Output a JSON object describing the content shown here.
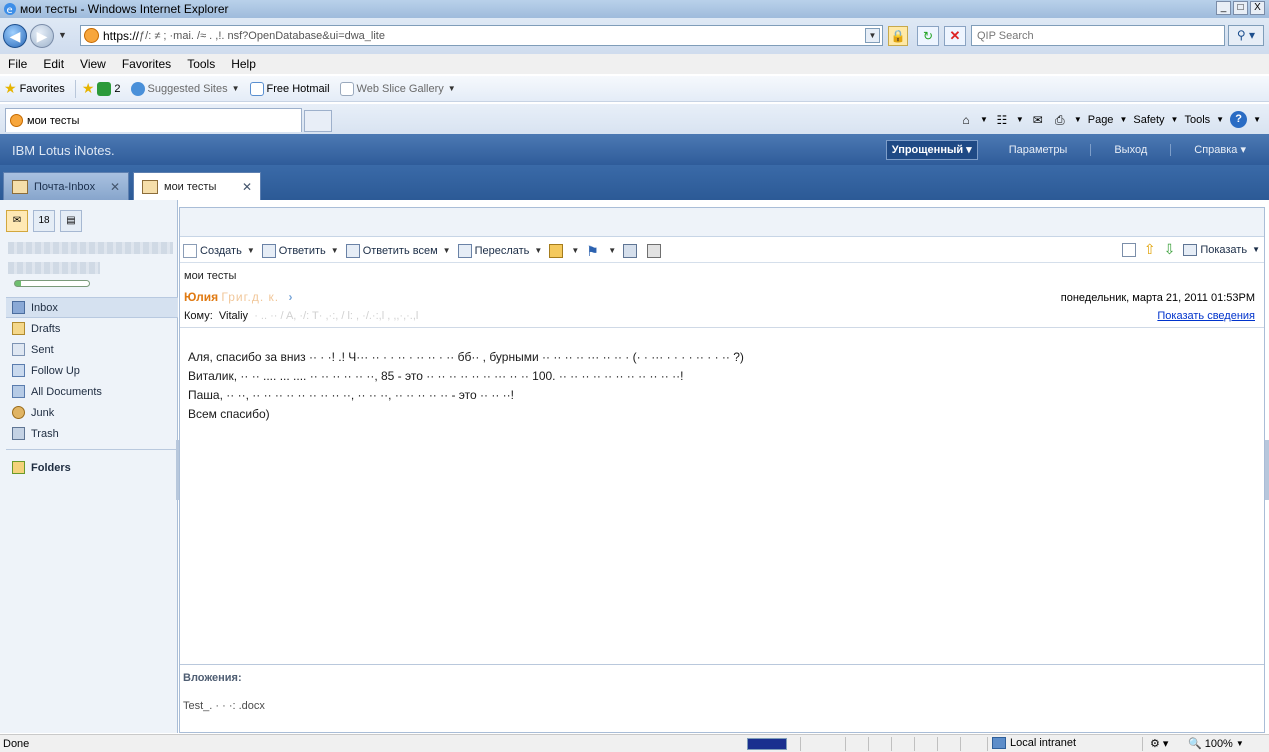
{
  "window": {
    "title": "мои тесты - Windows Internet Explorer",
    "buttons": [
      "_",
      "□",
      "X"
    ]
  },
  "address": {
    "prefix": "https://",
    "rest": "ƒ/: ≠ ; ·mai. /≈ . ,!. nsf?OpenDatabase&ui=dwa_lite",
    "search_placeholder": "QIP Search"
  },
  "menubar": [
    "File",
    "Edit",
    "View",
    "Favorites",
    "Tools",
    "Help"
  ],
  "favorites": {
    "favorites_label": "Favorites",
    "count": "2",
    "suggested": "Suggested Sites",
    "hotmail": "Free Hotmail",
    "webslice": "Web Slice Gallery"
  },
  "ie_tab": {
    "title": "мои тесты"
  },
  "commandbar": {
    "page": "Page",
    "safety": "Safety",
    "tools": "Tools"
  },
  "inotes": {
    "brand": "IBM Lotus iNotes.",
    "mode": "Упрощенный",
    "links": [
      "Параметры",
      "Выход",
      "Справка"
    ]
  },
  "apptabs": {
    "inbox_tab": "Почта-Inbox",
    "doc_tab": "мои тесты"
  },
  "sidebar": {
    "folders": [
      {
        "label": "Inbox",
        "icon": "inbox-icon"
      },
      {
        "label": "Drafts",
        "icon": "drafts-icon"
      },
      {
        "label": "Sent",
        "icon": "sent-icon"
      },
      {
        "label": "Follow Up",
        "icon": "follow-up-icon"
      },
      {
        "label": "All Documents",
        "icon": "all-documents-icon"
      },
      {
        "label": "Junk",
        "icon": "junk-icon"
      },
      {
        "label": "Trash",
        "icon": "trash-icon"
      }
    ],
    "folders_header": "Folders"
  },
  "toolbar": {
    "create": "Создать",
    "reply": "Ответить",
    "reply_all": "Ответить всем",
    "forward": "Переслать",
    "show": "Показать"
  },
  "message": {
    "subject": "мои тесты",
    "from": "Юлия",
    "from_rest": "Григ.д. к.",
    "date": "понедельник, марта 21, 2011 01:53PM",
    "to_label": "Кому:",
    "to_name": "Vitaliy",
    "to_rest": "· .. ·· / A, ·/: T· ,·:, / l: , ·/.·:,l , ,,·,·.,l",
    "show_details": "Показать сведения",
    "body_lines": [
      "Аля, спасибо за вниз ·· · ·! .! Ч··· ·· · · ·· · ·· ·· · ·· бб·· , бурными ·· ·· ·· ·· ··· ·· ·· · (· · ··· · · · · ·· · · ·· ?)",
      "Виталик, ·· ·· .... ... .... ·· ·· ·· ·· ·· ··, 85 - это ·· ·· ·· ·· ·· ·· ··· ·· ·· 100. ·· ·· ·· ·· ·· ·· ·· ·· ·· ·· ··!",
      "Паша, ·· ··, ·· ·· ·· ·· ·· ·· ·· ·· ··, ·· ·· ··, ·· ·· ·· ·· ·· - это ·· ·· ··!",
      "Всем спасибо)"
    ],
    "attachments_label": "Вложения:",
    "attachment_file": "Test_. · · ·: .docx"
  },
  "status": {
    "done": "Done",
    "zone": "Local intranet",
    "zoom": "100%"
  }
}
